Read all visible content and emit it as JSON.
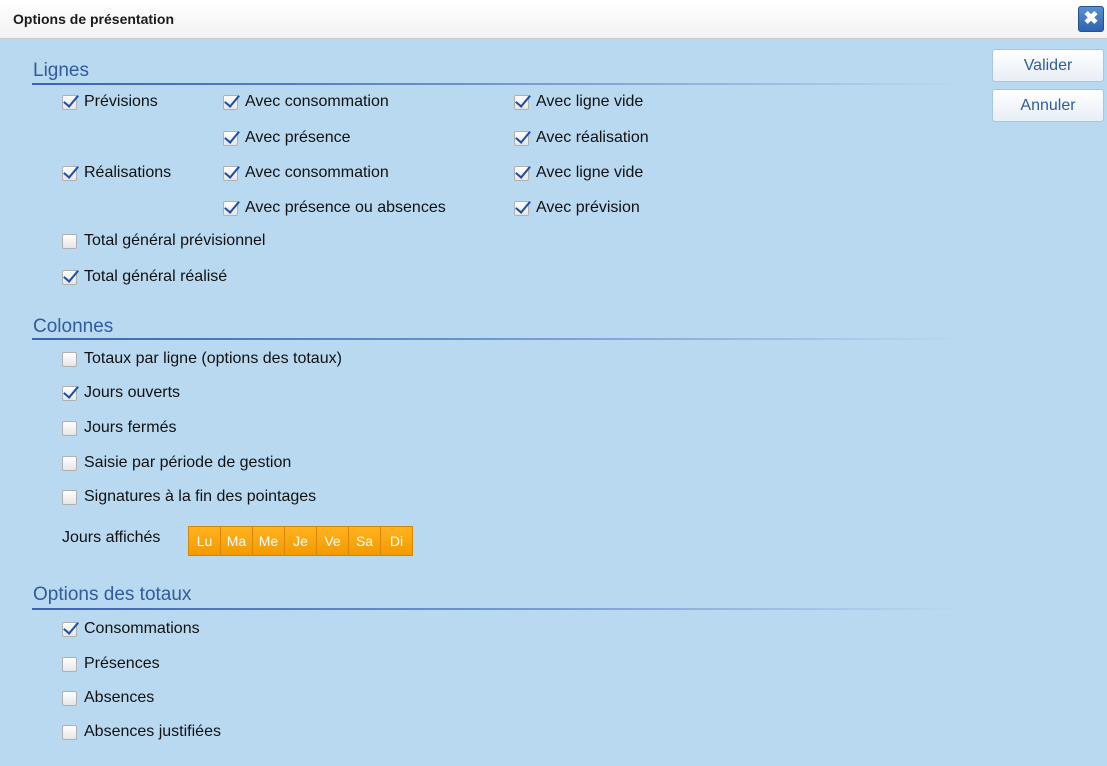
{
  "dialog": {
    "title": "Options de présentation",
    "close_icon": "close-icon"
  },
  "buttons": {
    "validate": "Valider",
    "cancel": "Annuler"
  },
  "sections": {
    "lignes": "Lignes",
    "colonnes": "Colonnes",
    "totaux": "Options des totaux"
  },
  "lignes": {
    "previsions": {
      "label": "Prévisions",
      "checked": true
    },
    "prev_consommation": {
      "label": "Avec consommation",
      "checked": true
    },
    "prev_ligne_vide": {
      "label": "Avec ligne vide",
      "checked": true
    },
    "prev_presence": {
      "label": "Avec présence",
      "checked": true
    },
    "prev_realisation": {
      "label": "Avec réalisation",
      "checked": true
    },
    "realisations": {
      "label": "Réalisations",
      "checked": true
    },
    "real_consommation": {
      "label": "Avec consommation",
      "checked": true
    },
    "real_ligne_vide": {
      "label": "Avec ligne vide",
      "checked": true
    },
    "real_presence_absences": {
      "label": "Avec présence ou absences",
      "checked": true
    },
    "real_prevision": {
      "label": "Avec prévision",
      "checked": true
    },
    "total_previsionnel": {
      "label": "Total général prévisionnel",
      "checked": false
    },
    "total_realise": {
      "label": "Total général réalisé",
      "checked": true
    }
  },
  "colonnes": {
    "totaux_par_ligne": {
      "label": "Totaux par ligne (options des totaux)",
      "checked": false
    },
    "jours_ouverts": {
      "label": "Jours ouverts",
      "checked": true
    },
    "jours_fermes": {
      "label": "Jours fermés",
      "checked": false
    },
    "saisie_periode": {
      "label": "Saisie par période de gestion",
      "checked": false
    },
    "signatures": {
      "label": "Signatures à la fin des pointages",
      "checked": false
    },
    "jours_affiches_label": "Jours affichés",
    "days": [
      "Lu",
      "Ma",
      "Me",
      "Je",
      "Ve",
      "Sa",
      "Di"
    ]
  },
  "totaux": {
    "consommations": {
      "label": "Consommations",
      "checked": true
    },
    "presences": {
      "label": "Présences",
      "checked": false
    },
    "absences": {
      "label": "Absences",
      "checked": false
    },
    "absences_justifiees": {
      "label": "Absences justifiées",
      "checked": false
    }
  },
  "colors": {
    "accent": "#2f5d9b",
    "panel": "#b9d9f1",
    "day_button": "#f7a30a"
  }
}
